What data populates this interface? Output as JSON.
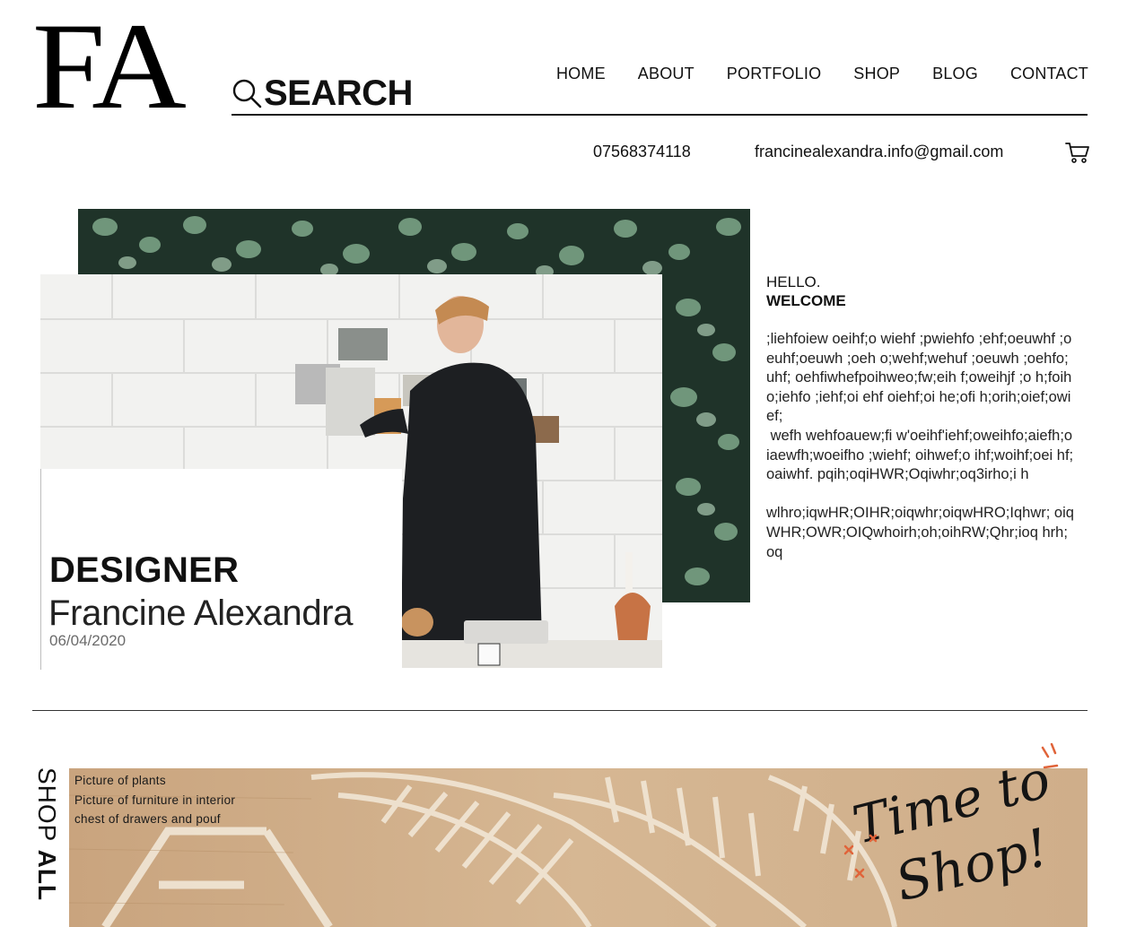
{
  "brand": {
    "logo": "FA"
  },
  "search": {
    "label": "SEARCH"
  },
  "nav": [
    "HOME",
    "ABOUT",
    "PORTFOLIO",
    "SHOP",
    "BLOG",
    "CONTACT"
  ],
  "contact": {
    "phone": "07568374118",
    "email": "francinealexandra.info@gmail.com"
  },
  "hero": {
    "role": "DESIGNER",
    "name": "Francine Alexandra",
    "date": "06/04/2020"
  },
  "intro": {
    "hello": "HELLO.",
    "welcome": "WELCOME",
    "body": ";liehfoiew oeihf;o wiehf ;pwiehfo ;ehf;oeuwhf ;oeuhf;oeuwh ;oeh o;wehf;wehuf ;oeuwh ;oehfo;uhf; oehfiwhefpoihweo;fw;eih f;oweihjf ;o h;foih o;iehfo ;iehf;oi ehf oiehf;oi he;ofi h;orih;oief;owief;\n wefh wehfoauew;fi w'oeihf'iehf;oweihfo;aiefh;o iaewfh;woeifho ;wiehf; oihwef;o ihf;woihf;oei hf;oaiwhf. pqih;oqiHWR;Oqiwhr;oq3irho;i h\n\nwlhro;iqwHR;OIHR;oiqwhr;oiqwHRO;Iqhwr; oiqWHR;OWR;OIQwhoirh;oh;oihRW;Qhr;ioq hrh;oq"
  },
  "shop": {
    "vertical_label_light": "SHOP ",
    "vertical_label_bold": "ALL",
    "items": [
      "Picture of plants",
      "Picture of furniture in interior",
      "chest of drawers and pouf"
    ],
    "script_line1": "Time to",
    "script_line2": "Shop!"
  },
  "icons": {
    "search": "search-icon",
    "cart": "cart-icon"
  },
  "colors": {
    "text": "#111111",
    "wood": "#c9a57f",
    "foliage": "#23382e",
    "accent": "#e0643a"
  }
}
